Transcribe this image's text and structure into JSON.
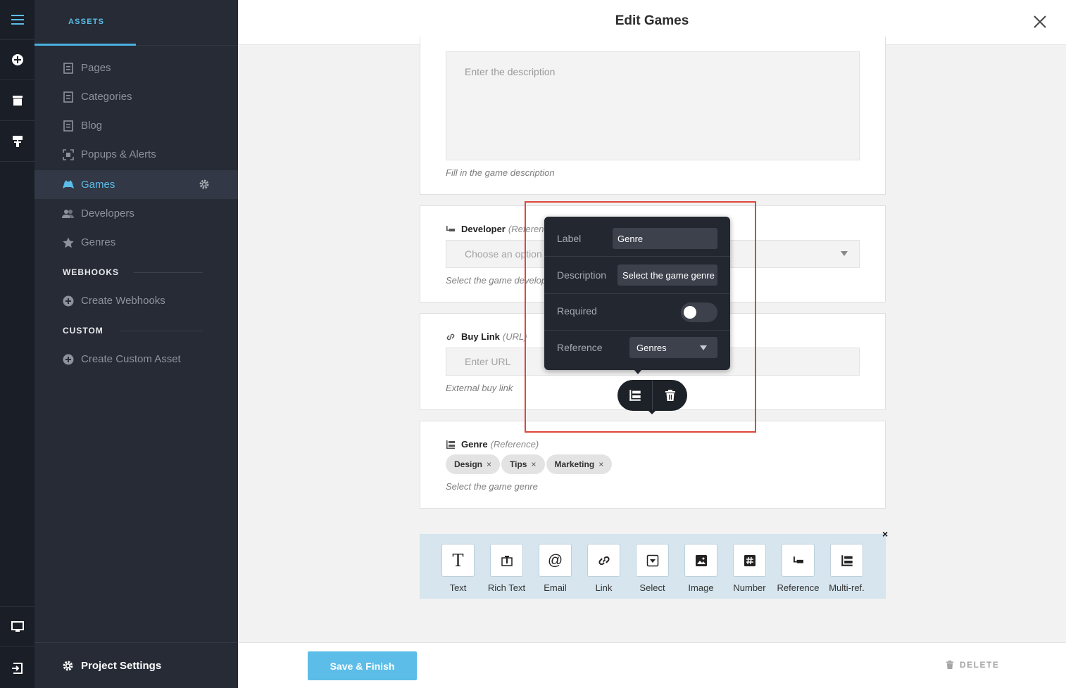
{
  "sidebar": {
    "tab": "ASSETS",
    "items": [
      {
        "label": "Pages",
        "icon": "page-icon"
      },
      {
        "label": "Categories",
        "icon": "page-icon"
      },
      {
        "label": "Blog",
        "icon": "page-icon"
      },
      {
        "label": "Popups & Alerts",
        "icon": "popup-icon"
      },
      {
        "label": "Games",
        "icon": "gamepad-icon"
      },
      {
        "label": "Developers",
        "icon": "users-icon"
      },
      {
        "label": "Genres",
        "icon": "star-icon"
      }
    ],
    "webhooks_title": "WEBHOOKS",
    "create_webhooks": "Create Webhooks",
    "custom_title": "CUSTOM",
    "create_custom": "Create Custom Asset",
    "project_settings": "Project Settings"
  },
  "header": {
    "title": "Edit Games"
  },
  "fields": {
    "description": {
      "placeholder": "Enter the description",
      "hint": "Fill in the game description"
    },
    "developer": {
      "label": "Developer",
      "kind": "(Reference)",
      "placeholder": "Choose an option",
      "hint": "Select the game developer"
    },
    "buylink": {
      "label": "Buy Link",
      "kind": "(URL)",
      "placeholder": "Enter URL",
      "hint": "External buy link"
    },
    "genre": {
      "label": "Genre",
      "kind": "(Reference)",
      "tags": [
        "Design",
        "Tips",
        "Marketing"
      ],
      "tag_remove": "×",
      "hint": "Select the game genre"
    }
  },
  "popover": {
    "label_title": "Label",
    "label_value": "Genre",
    "description_title": "Description",
    "description_value": "Select the game genre",
    "required_title": "Required",
    "required_on": false,
    "reference_title": "Reference",
    "reference_value": "Genres"
  },
  "palette": {
    "close": "×",
    "items": [
      {
        "label": "Text",
        "icon": "text-icon"
      },
      {
        "label": "Rich Text",
        "icon": "rich-text-icon"
      },
      {
        "label": "Email",
        "icon": "email-icon"
      },
      {
        "label": "Link",
        "icon": "link-icon"
      },
      {
        "label": "Select",
        "icon": "select-icon"
      },
      {
        "label": "Image",
        "icon": "image-icon"
      },
      {
        "label": "Number",
        "icon": "number-icon"
      },
      {
        "label": "Reference",
        "icon": "reference-icon"
      },
      {
        "label": "Multi-ref.",
        "icon": "multi-ref-icon"
      }
    ]
  },
  "footer": {
    "save": "Save & Finish",
    "delete": "DELETE"
  },
  "colors": {
    "accent": "#5bbde8",
    "sidebar_bg": "#262b35",
    "rail_bg": "#1a1e26",
    "highlight": "#e0463a"
  }
}
